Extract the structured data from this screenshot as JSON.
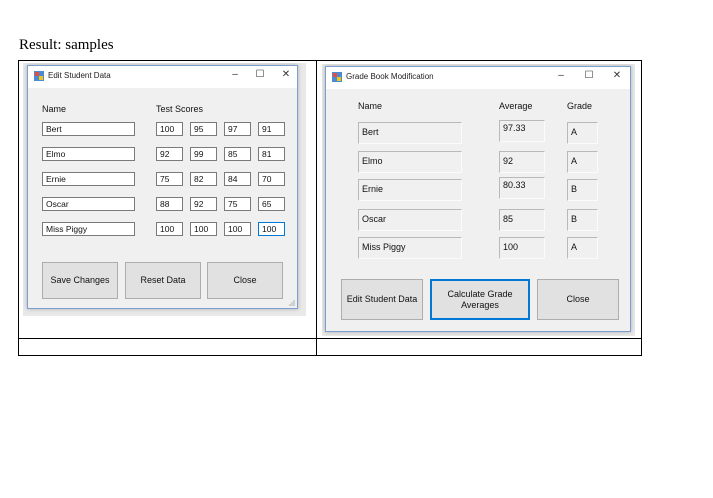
{
  "document": {
    "heading": "Result: samples"
  },
  "edit_window": {
    "title": "Edit Student Data",
    "controls": {
      "minimize": "–",
      "maximize": "☐",
      "close": "✕"
    },
    "name_header": "Name",
    "scores_header": "Test Scores",
    "rows": [
      {
        "name": "Bert",
        "scores": [
          "100",
          "95",
          "97",
          "91"
        ]
      },
      {
        "name": "Elmo",
        "scores": [
          "92",
          "99",
          "85",
          "81"
        ]
      },
      {
        "name": "Ernie",
        "scores": [
          "75",
          "82",
          "84",
          "70"
        ]
      },
      {
        "name": "Oscar",
        "scores": [
          "88",
          "92",
          "75",
          "65"
        ]
      },
      {
        "name": "Miss Piggy",
        "scores": [
          "100",
          "100",
          "100",
          "100"
        ]
      }
    ],
    "buttons": {
      "save": "Save Changes",
      "reset": "Reset Data",
      "close": "Close"
    }
  },
  "gradebook_window": {
    "title": "Grade Book Modification",
    "controls": {
      "minimize": "–",
      "maximize": "☐",
      "close": "✕"
    },
    "name_header": "Name",
    "average_header": "Average",
    "grade_header": "Grade",
    "rows": [
      {
        "name": "Bert",
        "average": "97.33",
        "grade": "A"
      },
      {
        "name": "Elmo",
        "average": "92",
        "grade": "A"
      },
      {
        "name": "Ernie",
        "average": "80.33",
        "grade": "B"
      },
      {
        "name": "Oscar",
        "average": "85",
        "grade": "B"
      },
      {
        "name": "Miss Piggy",
        "average": "100",
        "grade": "A"
      }
    ],
    "buttons": {
      "edit": "Edit Student Data",
      "calculate": "Calculate Grade Averages",
      "close": "Close"
    }
  },
  "colors": {
    "window_bg": "#f0f0f0",
    "accent": "#0078d7",
    "button_bg": "#e1e1e1"
  },
  "icons": [
    "app-icon",
    "minimize-icon",
    "maximize-icon",
    "close-icon",
    "resize-grip-icon"
  ]
}
